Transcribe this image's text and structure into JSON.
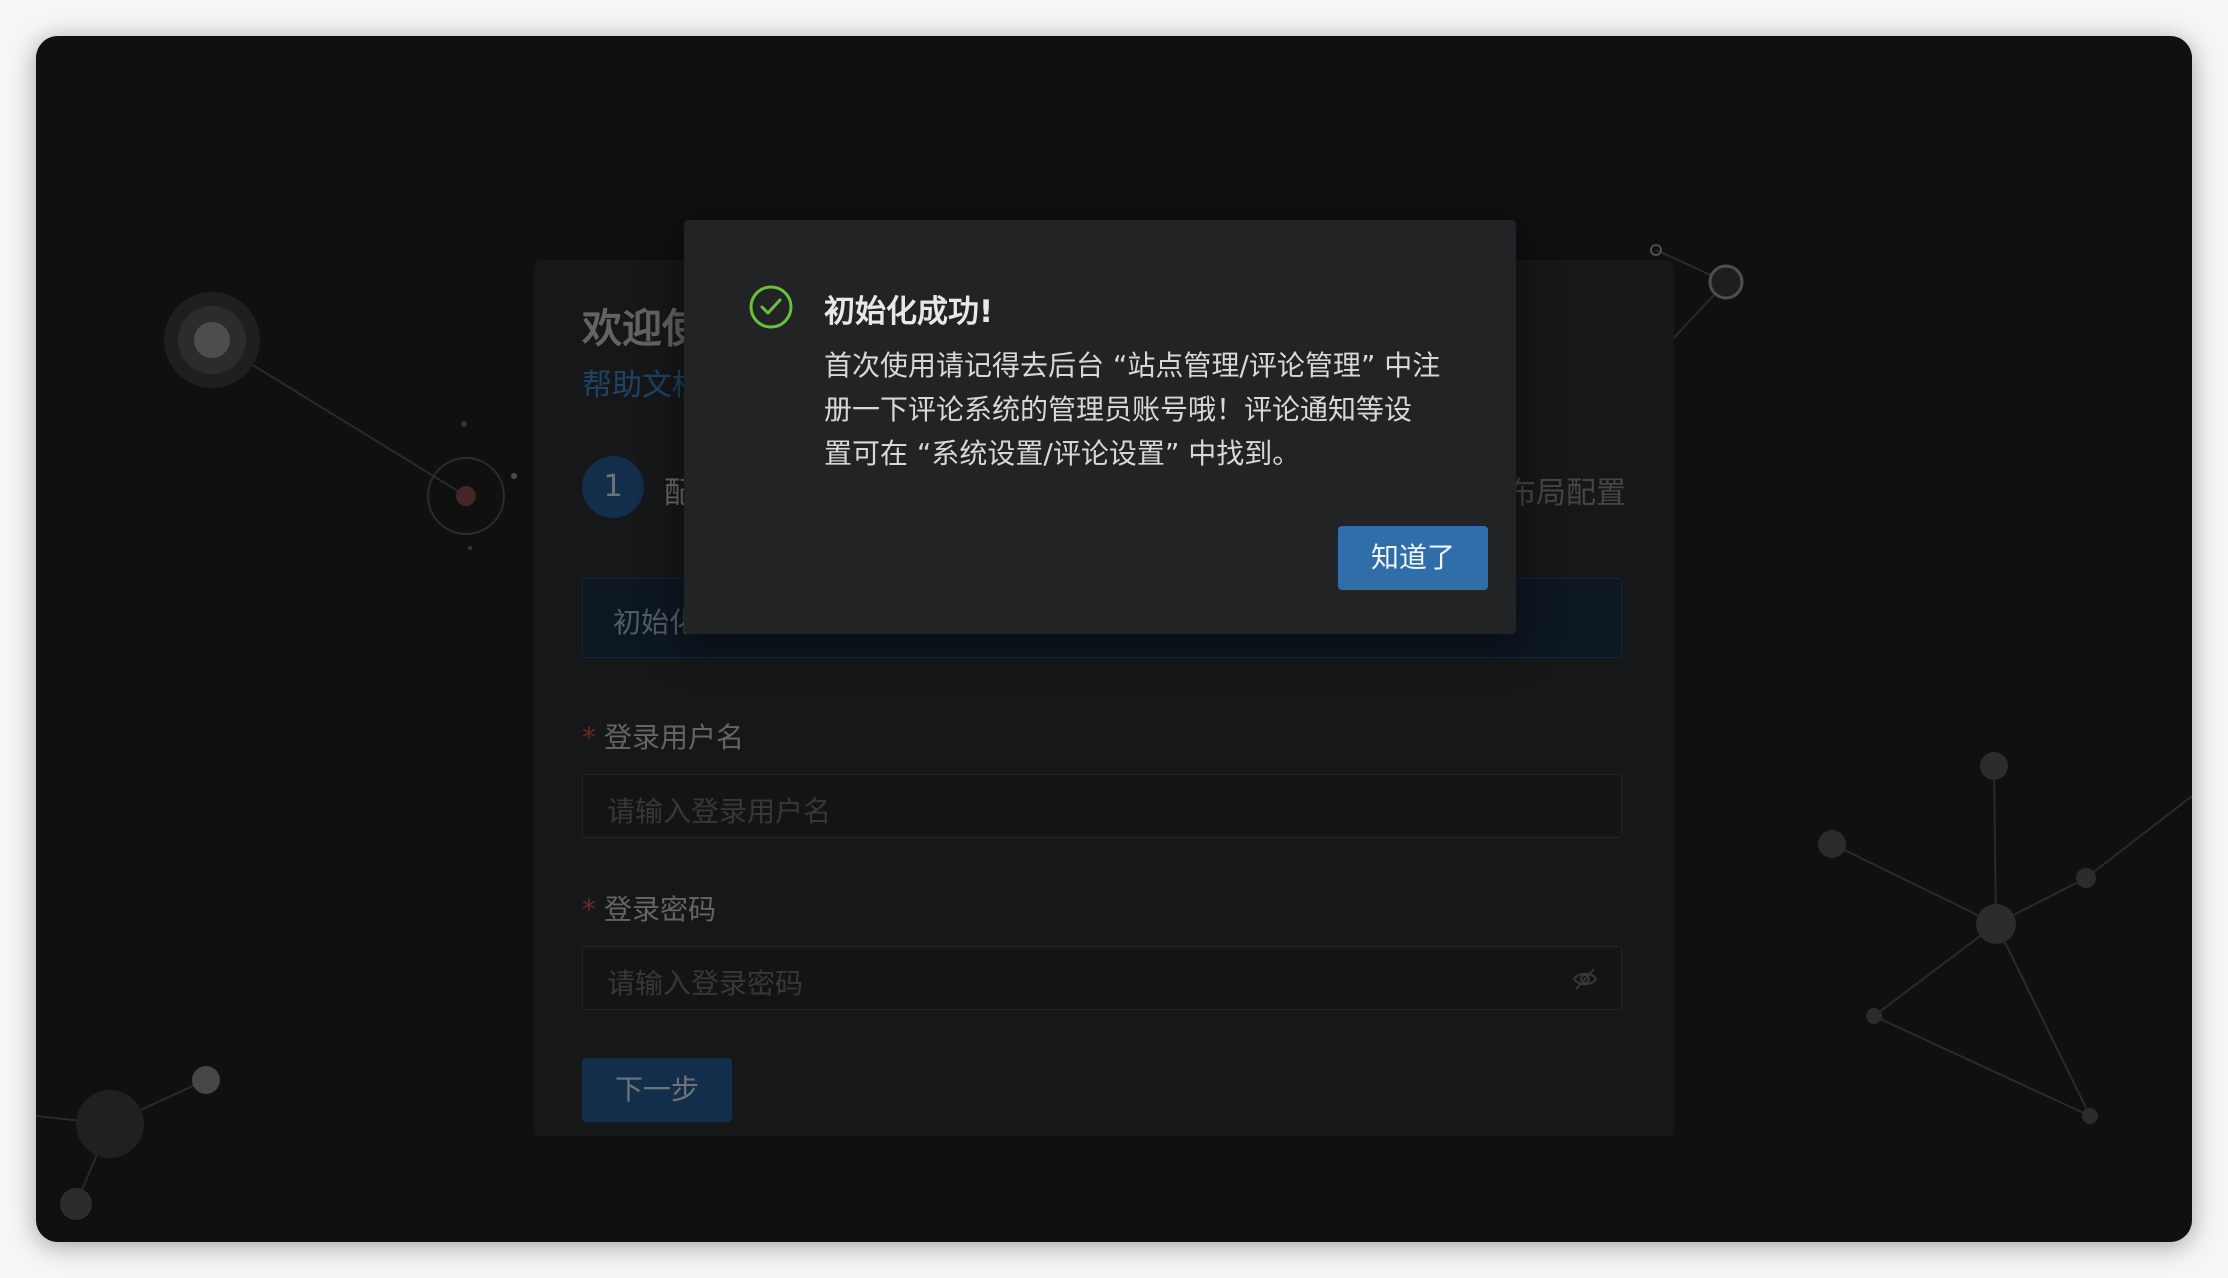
{
  "setup": {
    "welcome_text": "欢迎使",
    "help_link": "帮助文档",
    "step_number": "1",
    "step_label": "配",
    "step_label_right": "布局配置",
    "info_banner": "初始化",
    "username": {
      "label": "登录用户名",
      "placeholder": "请输入登录用户名"
    },
    "password": {
      "label": "登录密码",
      "placeholder": "请输入登录密码"
    },
    "required_mark": "*",
    "next_button": "下一步"
  },
  "modal": {
    "title": "初始化成功!",
    "body_lines": [
      "首次使用请记得去后台 “站点管理/评论管理” 中注",
      "册一下评论系统的管理员账号哦！评论通知等设",
      "置可在 “系统设置/评论设置” 中找到。"
    ],
    "confirm_button": "知道了"
  },
  "colors": {
    "primary": "#2f6ea8",
    "success": "#67c23a",
    "required": "#d9534f",
    "background": "#1f2021"
  },
  "icons": {
    "success": "check-circle-icon",
    "password_toggle": "eye-off-icon"
  }
}
